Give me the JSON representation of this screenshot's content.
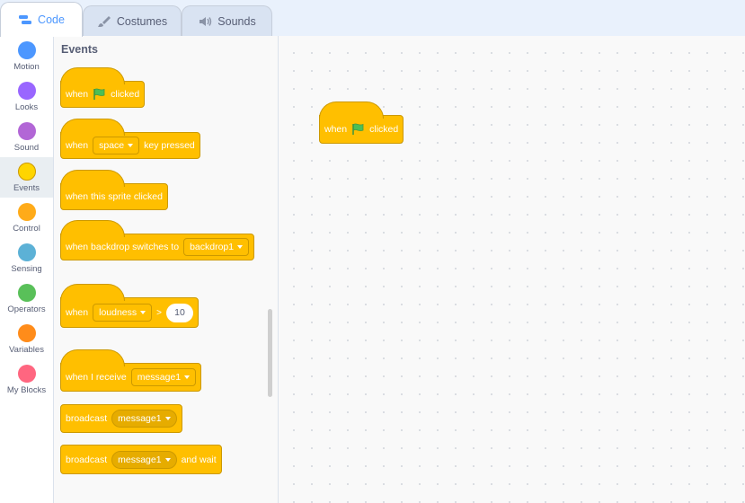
{
  "tabs": {
    "code": "Code",
    "costumes": "Costumes",
    "sounds": "Sounds"
  },
  "categories": [
    {
      "label": "Motion",
      "color": "#4c97ff"
    },
    {
      "label": "Looks",
      "color": "#9966ff"
    },
    {
      "label": "Sound",
      "color": "#b266d6"
    },
    {
      "label": "Events",
      "color": "#ffd500"
    },
    {
      "label": "Control",
      "color": "#ffab19"
    },
    {
      "label": "Sensing",
      "color": "#5cb1d6"
    },
    {
      "label": "Operators",
      "color": "#59c059"
    },
    {
      "label": "Variables",
      "color": "#ff8c1a"
    },
    {
      "label": "My Blocks",
      "color": "#ff6680"
    }
  ],
  "selected_category": "Events",
  "palette": {
    "title": "Events",
    "blocks": {
      "flag_clicked": {
        "when": "when",
        "clicked": "clicked"
      },
      "key_pressed": {
        "when": "when",
        "key": "space",
        "suffix": "key pressed"
      },
      "sprite_clicked": {
        "text": "when this sprite clicked"
      },
      "backdrop_switches": {
        "text": "when backdrop switches to",
        "backdrop": "backdrop1"
      },
      "loudness": {
        "when": "when",
        "sensor": "loudness",
        "op": ">",
        "value": "10"
      },
      "receive": {
        "text": "when I receive",
        "message": "message1"
      },
      "broadcast": {
        "text": "broadcast",
        "message": "message1"
      },
      "broadcast_wait": {
        "text": "broadcast",
        "message": "message1",
        "suffix": "and wait"
      }
    }
  },
  "workspace": {
    "script_block": {
      "when": "when",
      "clicked": "clicked"
    }
  },
  "colors": {
    "events": "#ffbf00",
    "events_border": "#cc9900",
    "accent": "#4c97ff",
    "flag_green": "#4cbf56"
  }
}
